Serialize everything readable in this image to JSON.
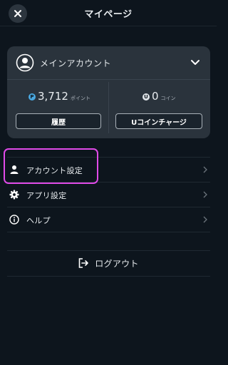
{
  "header": {
    "title": "マイページ",
    "close_icon": "close-icon"
  },
  "account": {
    "name": "メインアカウント",
    "avatar_icon": "user-circle-icon",
    "expand_icon": "chevron-down-icon"
  },
  "points": {
    "badge": "P",
    "value": "3,712",
    "unit": "ポイント",
    "color": "#4aa8e0"
  },
  "coins": {
    "badge": "U",
    "value": "0",
    "unit": "コイン"
  },
  "buttons": {
    "history": "履歴",
    "charge": "Uコインチャージ"
  },
  "menu": [
    {
      "label": "アカウント設定",
      "icon": "person-icon"
    },
    {
      "label": "アプリ設定",
      "icon": "gear-icon"
    },
    {
      "label": "ヘルプ",
      "icon": "info-icon"
    }
  ],
  "logout": {
    "label": "ログアウト",
    "icon": "logout-icon"
  },
  "colors": {
    "background": "#0d151d",
    "card": "#2a333c",
    "highlight": "#e04ae8"
  }
}
